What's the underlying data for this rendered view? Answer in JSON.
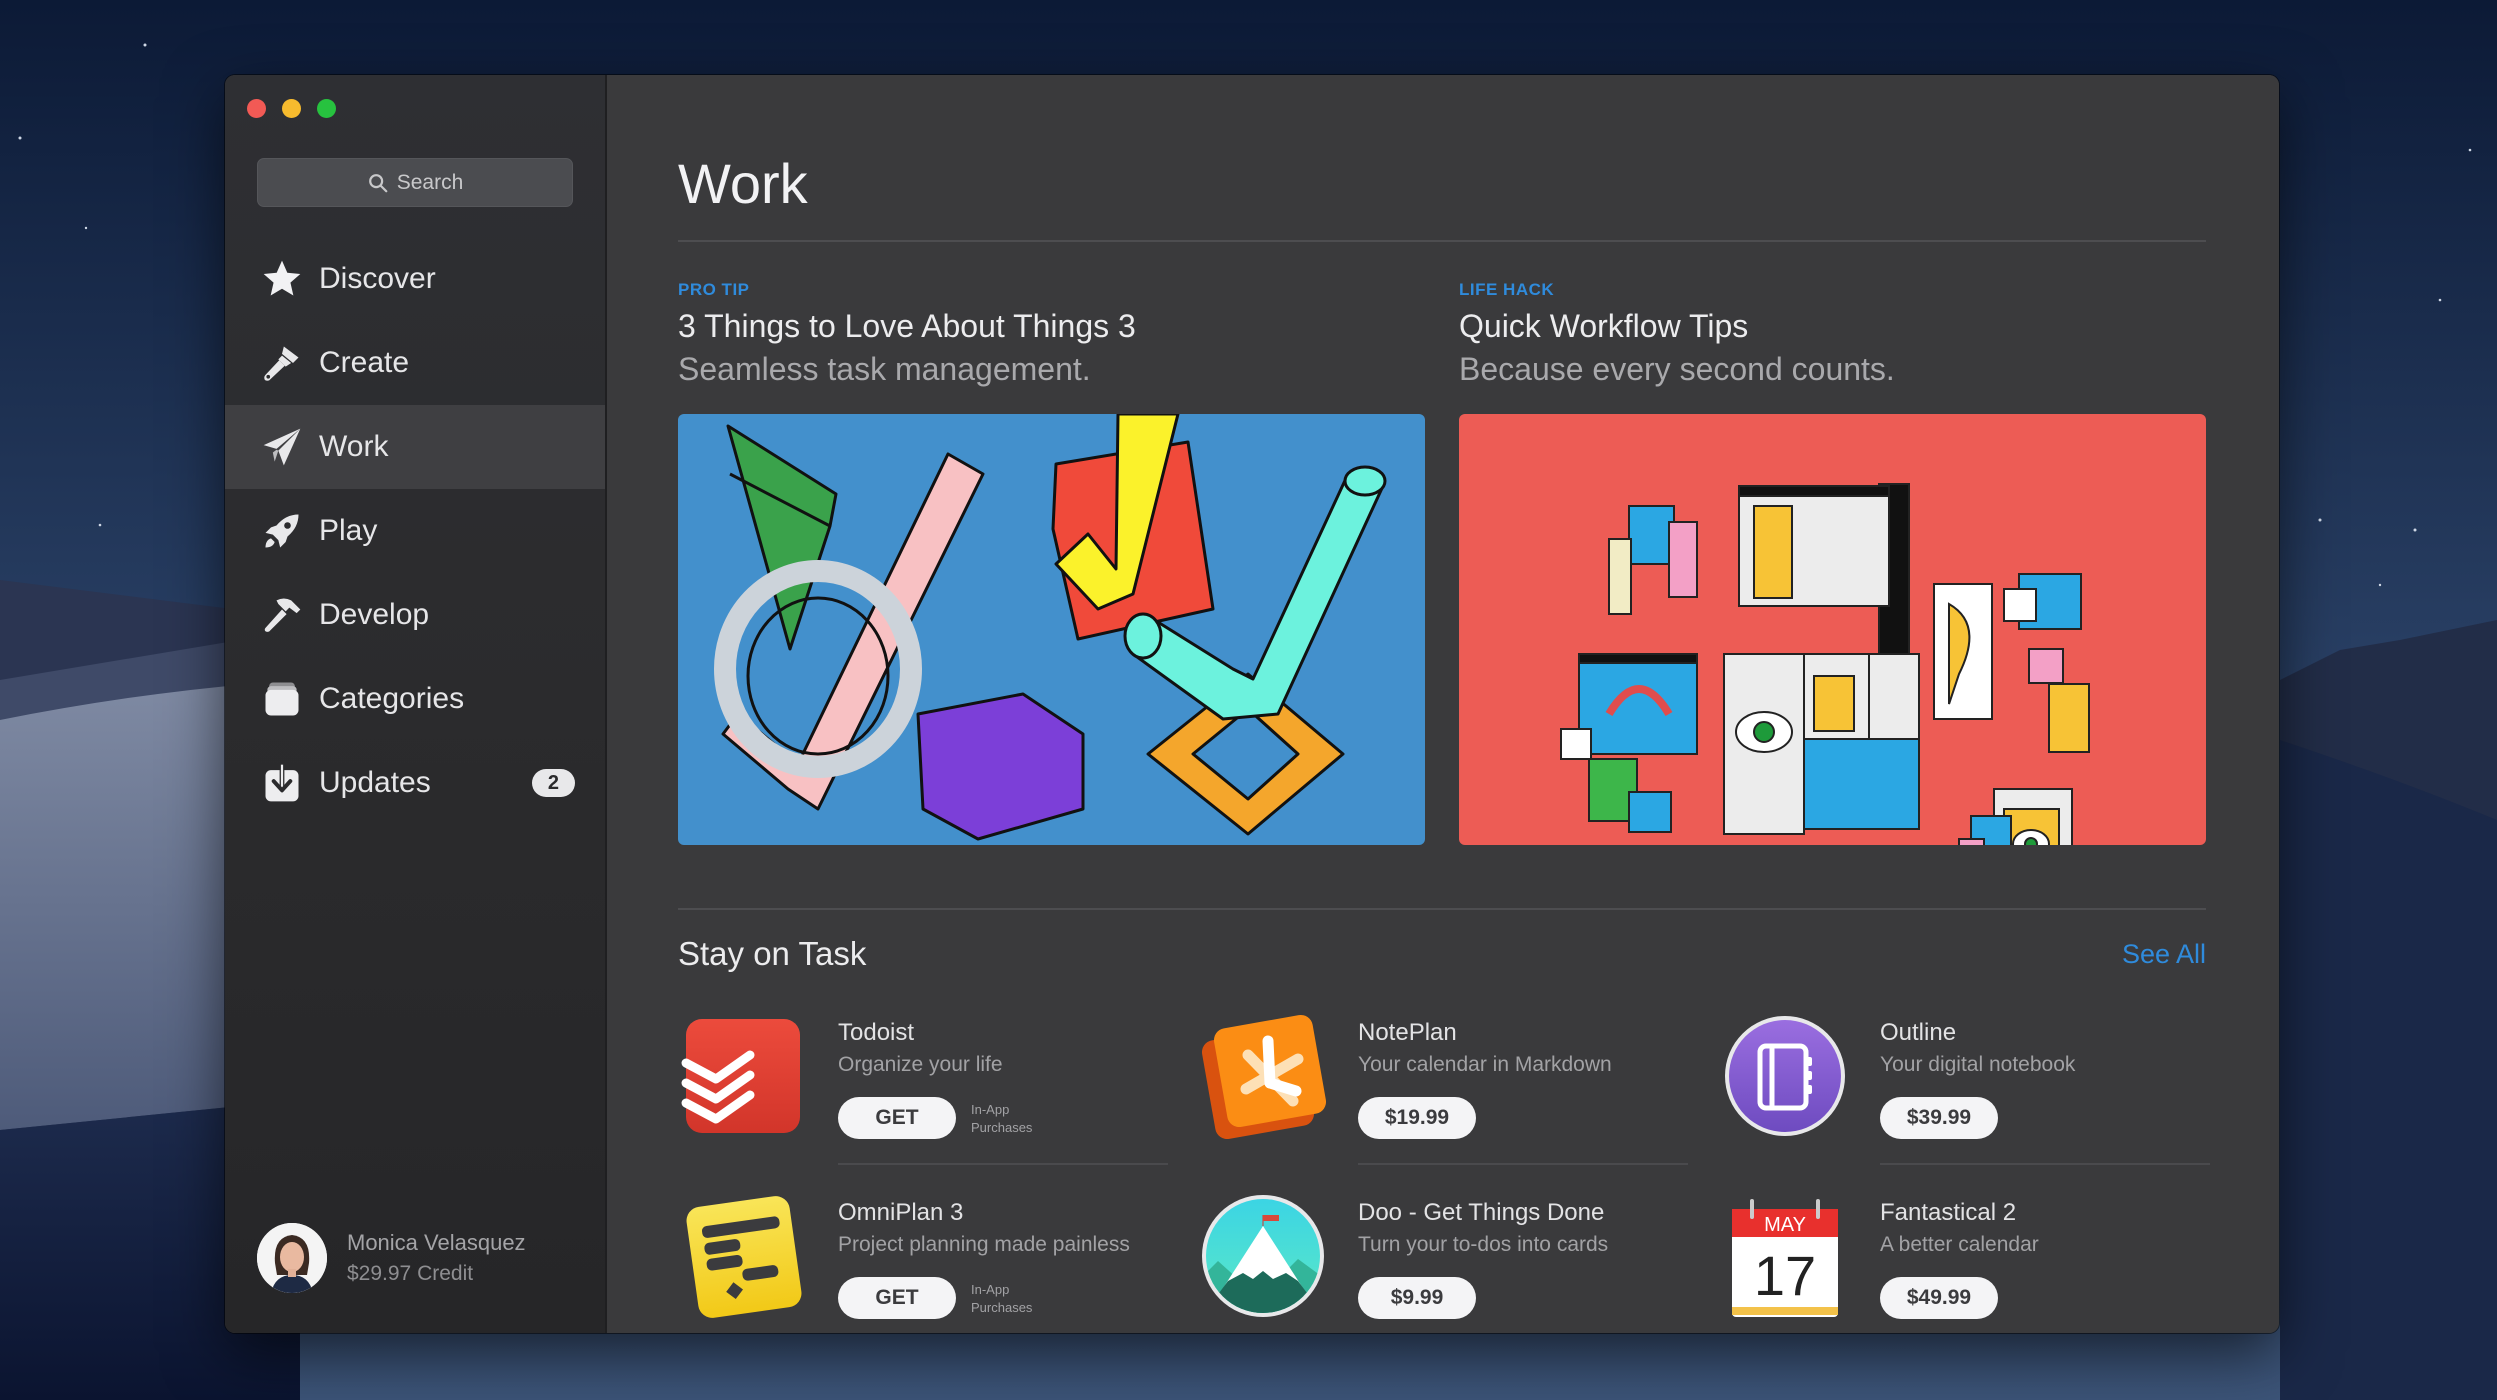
{
  "window": {
    "traffic_lights": [
      "close",
      "minimize",
      "zoom"
    ]
  },
  "sidebar": {
    "search": {
      "placeholder": "Search",
      "icon": "magnifying-glass-icon"
    },
    "items": [
      {
        "label": "Discover",
        "icon": "star-icon",
        "active": false
      },
      {
        "label": "Create",
        "icon": "paintbrush-icon",
        "active": false
      },
      {
        "label": "Work",
        "icon": "paper-plane-icon",
        "active": true
      },
      {
        "label": "Play",
        "icon": "rocket-icon",
        "active": false
      },
      {
        "label": "Develop",
        "icon": "hammer-icon",
        "active": false
      },
      {
        "label": "Categories",
        "icon": "stacked-boxes-icon",
        "active": false
      },
      {
        "label": "Updates",
        "icon": "download-tray-icon",
        "active": false,
        "badge": "2"
      }
    ],
    "profile": {
      "name": "Monica Velasquez",
      "credit": "$29.97 Credit"
    }
  },
  "main": {
    "title": "Work",
    "features": [
      {
        "label": "PRO TIP",
        "title": "3 Things to Love About Things 3",
        "subtitle": "Seamless task management.",
        "background": "#4390cc"
      },
      {
        "label": "LIFE HACK",
        "title": "Quick Workflow Tips",
        "subtitle": "Because every second counts.",
        "background": "#ed5c55"
      }
    ],
    "section": {
      "title": "Stay on Task",
      "see_all": "See All",
      "apps": [
        {
          "name": "Todoist",
          "description": "Organize your life",
          "button": "GET",
          "in_app": [
            "In-App",
            "Purchases"
          ]
        },
        {
          "name": "NotePlan",
          "description": "Your calendar in Markdown",
          "button": "$19.99"
        },
        {
          "name": "Outline",
          "description": "Your digital notebook",
          "button": "$39.99"
        },
        {
          "name": "OmniPlan 3",
          "description": "Project planning made painless",
          "button": "GET",
          "in_app": [
            "In-App",
            "Purchases"
          ]
        },
        {
          "name": "Doo - Get Things Done",
          "description": "Turn your to-dos into cards",
          "button": "$9.99"
        },
        {
          "name": "Fantastical 2",
          "description": "A better calendar",
          "button": "$49.99",
          "icon_text": {
            "month": "MAY",
            "day": "17"
          }
        }
      ]
    }
  },
  "colors": {
    "accent": "#2f8bdc",
    "window_bg": "#3a3a3c",
    "sidebar_bg": "#2b2b2d"
  }
}
